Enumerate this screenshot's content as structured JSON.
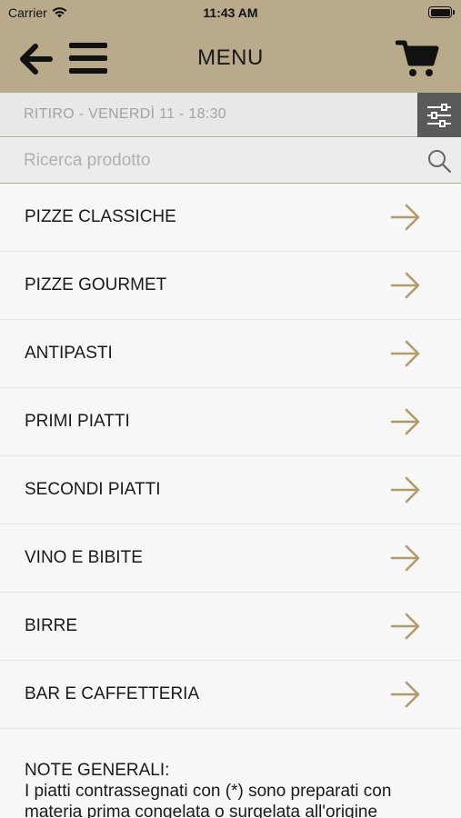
{
  "status_bar": {
    "carrier": "Carrier",
    "time": "11:43 AM"
  },
  "nav": {
    "title": "MENU",
    "back_icon": "back-arrow-icon",
    "menu_icon": "hamburger-icon",
    "cart_icon": "cart-icon"
  },
  "pickup": {
    "label": "RITIRO - VENERDÌ 11 - 18:30",
    "filter_icon": "filter-sliders-icon"
  },
  "search": {
    "placeholder": "Ricerca prodotto",
    "icon": "search-icon"
  },
  "categories": [
    {
      "label": "PIZZE CLASSICHE"
    },
    {
      "label": "PIZZE GOURMET"
    },
    {
      "label": "ANTIPASTI"
    },
    {
      "label": "PRIMI PIATTI"
    },
    {
      "label": "SECONDI PIATTI"
    },
    {
      "label": "VINO E BIBITE"
    },
    {
      "label": "BIRRE"
    },
    {
      "label": "BAR E CAFFETTERIA"
    }
  ],
  "notes": {
    "heading": "NOTE GENERALI:",
    "text": "I piatti contrassegnati con (*) sono preparati con materia prima congelata o surgelata all'origine"
  },
  "colors": {
    "header_bg": "#b8aa8b",
    "accent": "#b39a6a",
    "filter_bg": "#5a5a5a"
  }
}
